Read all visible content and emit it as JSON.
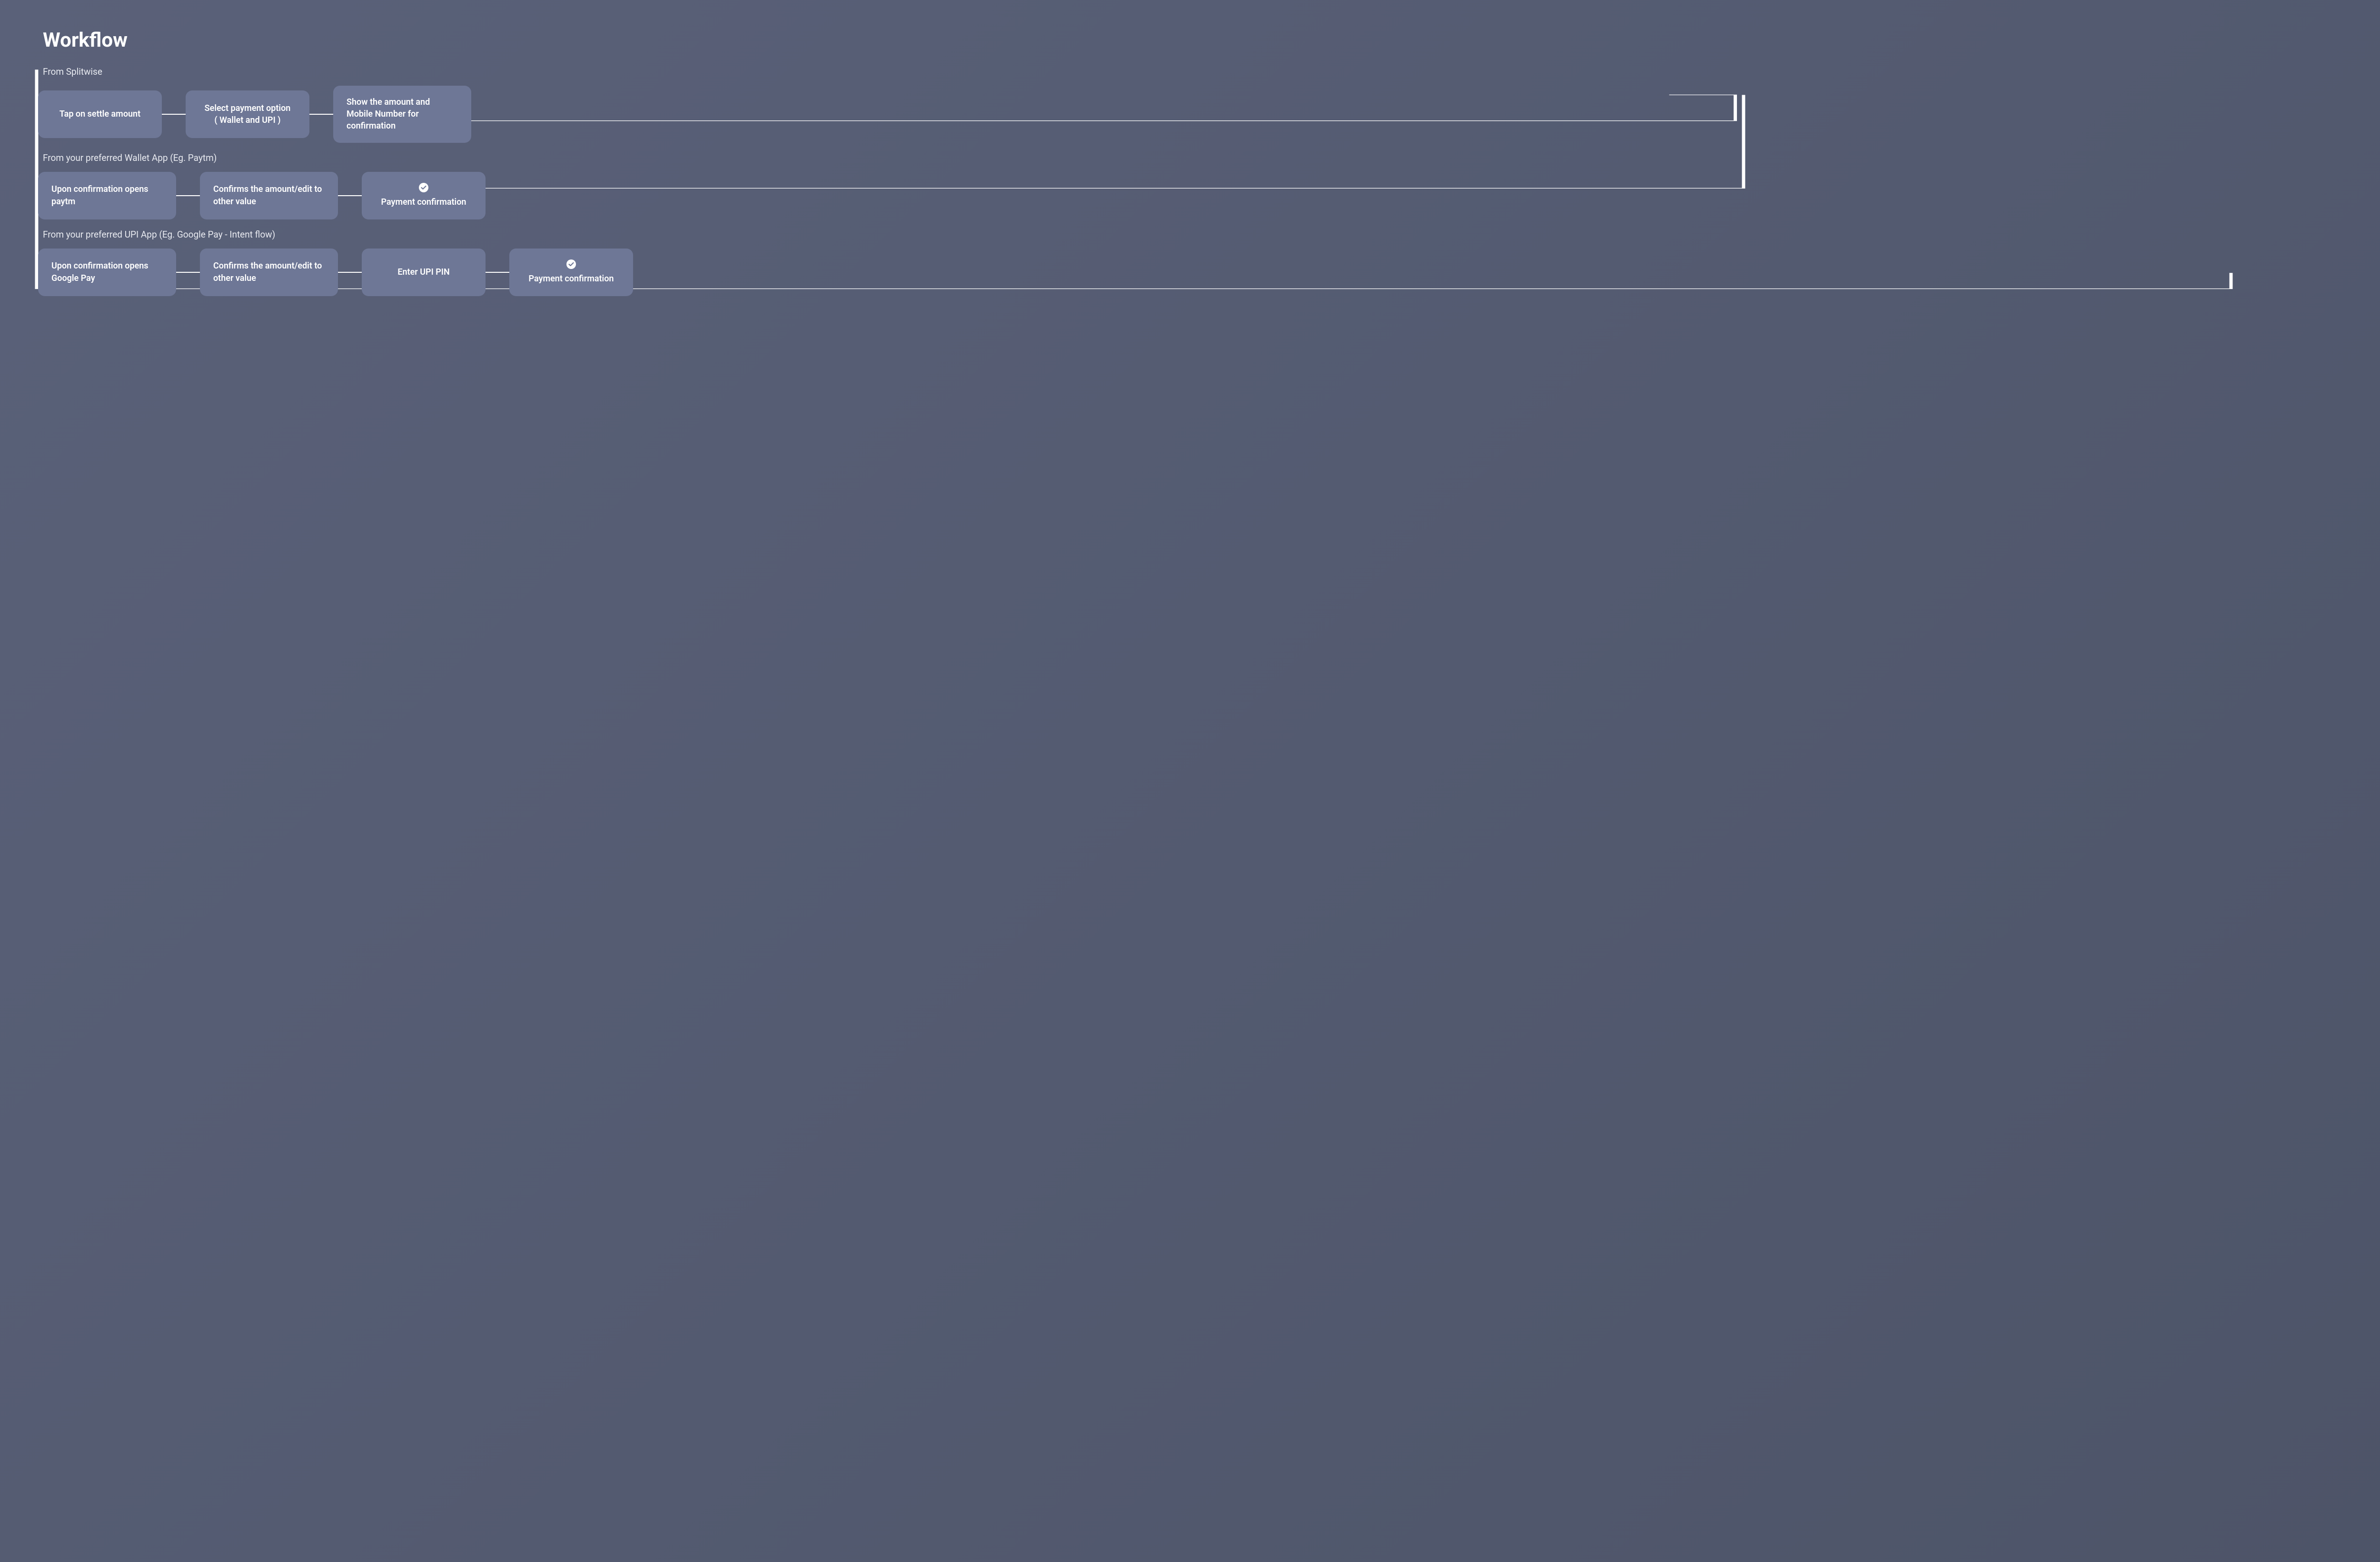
{
  "title": "Workflow",
  "sections": [
    {
      "label": "From Splitwise",
      "nodes": [
        {
          "text": "Tap on settle amount",
          "align": "center",
          "hasIcon": false
        },
        {
          "text": "Select payment option\n( Wallet and UPI )",
          "align": "center",
          "hasIcon": false
        },
        {
          "text": "Show  the  amount and Mobile Number  for confirmation",
          "align": "left",
          "hasIcon": false
        }
      ]
    },
    {
      "label": "From your preferred Wallet App (Eg. Paytm)",
      "nodes": [
        {
          "text": "Upon confirmation opens paytm",
          "align": "left",
          "hasIcon": false
        },
        {
          "text": "Confirms the amount/edit to other value",
          "align": "left",
          "hasIcon": false
        },
        {
          "text": "Payment confirmation",
          "align": "center",
          "hasIcon": true
        }
      ]
    },
    {
      "label": "From your preferred UPI App (Eg. Google Pay - Intent flow)",
      "nodes": [
        {
          "text": "Upon confirmation opens Google Pay",
          "align": "left",
          "hasIcon": false
        },
        {
          "text": "Confirms the amount/edit to other value",
          "align": "left",
          "hasIcon": false
        },
        {
          "text": "Enter UPI PIN",
          "align": "center",
          "hasIcon": false
        },
        {
          "text": "Payment confirmation",
          "align": "center",
          "hasIcon": true
        }
      ]
    }
  ]
}
